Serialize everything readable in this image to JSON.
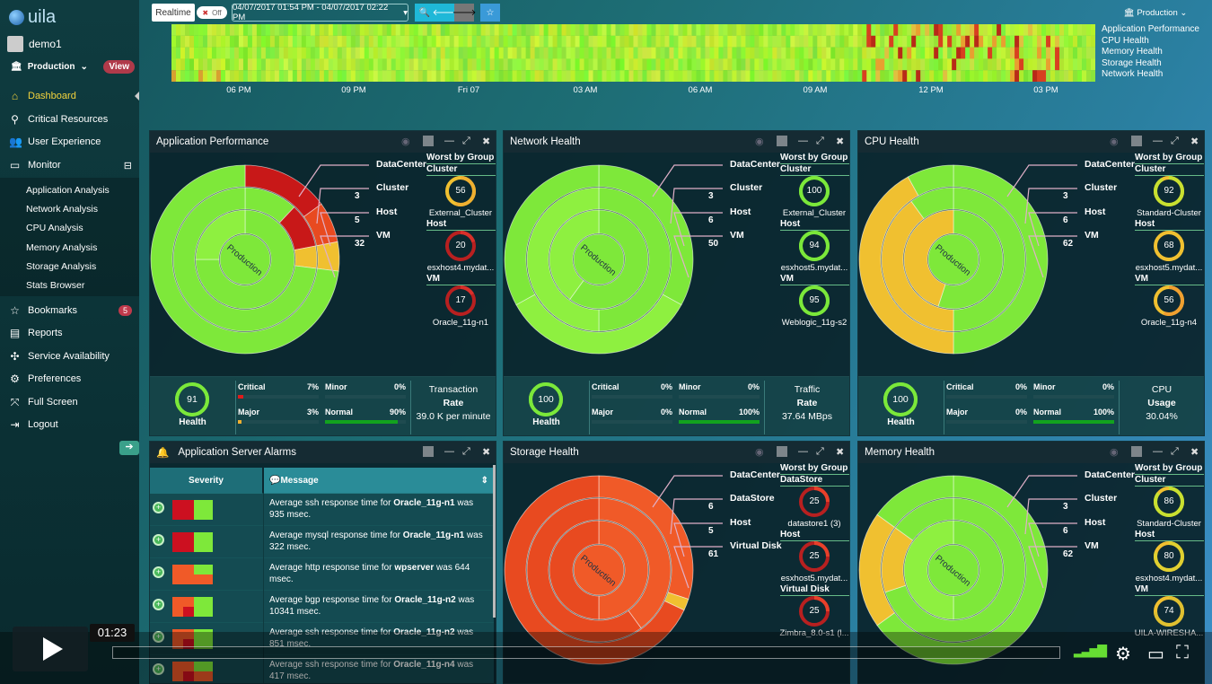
{
  "app": {
    "logo": "uila",
    "user": "demo1",
    "environment": "Production",
    "view_label": "View"
  },
  "nav": {
    "items": [
      {
        "label": "Dashboard",
        "icon": "home-icon"
      },
      {
        "label": "Critical Resources",
        "icon": "map-pin-icon"
      },
      {
        "label": "User Experience",
        "icon": "users-icon"
      },
      {
        "label": "Monitor",
        "icon": "monitor-icon",
        "toggle": "⊟"
      },
      {
        "label": "Bookmarks",
        "icon": "star-icon",
        "badge": "5"
      },
      {
        "label": "Reports",
        "icon": "report-icon"
      },
      {
        "label": "Service Availability",
        "icon": "settings-network-icon"
      },
      {
        "label": "Preferences",
        "icon": "preferences-icon"
      },
      {
        "label": "Full Screen",
        "icon": "fullscreen-icon"
      },
      {
        "label": "Logout",
        "icon": "logout-icon"
      }
    ],
    "monitor_sub": [
      "Application Analysis",
      "Network Analysis",
      "CPU Analysis",
      "Memory Analysis",
      "Storage Analysis",
      "Stats Browser"
    ]
  },
  "toolbar": {
    "realtime": "Realtime",
    "toggle_state": "Off",
    "date_range": "04/07/2017 01:54 PM - 04/07/2017 02:22 PM",
    "environment": "Production"
  },
  "timeline": {
    "ticks": [
      "06 PM",
      "09 PM",
      "Fri 07",
      "03 AM",
      "06 AM",
      "09 AM",
      "12 PM",
      "03 PM"
    ],
    "rows": [
      "Application Performance",
      "CPU Health",
      "Memory Health",
      "Storage Health",
      "Network Health"
    ]
  },
  "worst_title": "Worst by Group",
  "panels": [
    {
      "id": "app",
      "title": "Application Performance",
      "center": "Production",
      "legend": [
        {
          "label": "DataCenter",
          "count": ""
        },
        {
          "label": "Cluster",
          "count": "3"
        },
        {
          "label": "Host",
          "count": "5"
        },
        {
          "label": "VM",
          "count": "32"
        }
      ],
      "worst": [
        {
          "group": "Cluster",
          "value": 56,
          "name": "External_Cluster",
          "color": "#f0b030"
        },
        {
          "group": "Host",
          "value": 20,
          "name": "esxhost4.mydat...",
          "color": "#d8302a"
        },
        {
          "group": "VM",
          "value": 17,
          "name": "Oracle_11g-n1",
          "color": "#d8302a"
        }
      ],
      "health": 91,
      "health_label": "Health",
      "severity": [
        {
          "label": "Critical",
          "pct": 7,
          "color": "#e01b1b"
        },
        {
          "label": "Minor",
          "pct": 0,
          "color": "#f0b030"
        },
        {
          "label": "Major",
          "pct": 3,
          "color": "#f0b030"
        },
        {
          "label": "Normal",
          "pct": 90,
          "color": "#12a21e"
        }
      ],
      "metric": [
        "Transaction",
        "Rate",
        "39.0 K per minute"
      ]
    },
    {
      "id": "net",
      "title": "Network Health",
      "center": "Production",
      "legend": [
        {
          "label": "DataCenter",
          "count": ""
        },
        {
          "label": "Cluster",
          "count": "3"
        },
        {
          "label": "Host",
          "count": "6"
        },
        {
          "label": "VM",
          "count": "50"
        }
      ],
      "worst": [
        {
          "group": "Cluster",
          "value": 100,
          "name": "External_Cluster",
          "color": "#7be83a"
        },
        {
          "group": "Host",
          "value": 94,
          "name": "esxhost5.mydat...",
          "color": "#7be83a"
        },
        {
          "group": "VM",
          "value": 95,
          "name": "Weblogic_11g-s2",
          "color": "#7be83a"
        }
      ],
      "health": 100,
      "health_label": "Health",
      "severity": [
        {
          "label": "Critical",
          "pct": 0,
          "color": "#e01b1b"
        },
        {
          "label": "Minor",
          "pct": 0,
          "color": "#f0b030"
        },
        {
          "label": "Major",
          "pct": 0,
          "color": "#f0b030"
        },
        {
          "label": "Normal",
          "pct": 100,
          "color": "#12a21e"
        }
      ],
      "metric": [
        "Traffic",
        "Rate",
        "37.64 MBps"
      ]
    },
    {
      "id": "cpu",
      "title": "CPU Health",
      "center": "Production",
      "legend": [
        {
          "label": "DataCenter",
          "count": ""
        },
        {
          "label": "Cluster",
          "count": "3"
        },
        {
          "label": "Host",
          "count": "6"
        },
        {
          "label": "VM",
          "count": "62"
        }
      ],
      "worst": [
        {
          "group": "Cluster",
          "value": 92,
          "name": "Standard-Cluster",
          "color": "#c8e030"
        },
        {
          "group": "Host",
          "value": 68,
          "name": "esxhost5.mydat...",
          "color": "#f0c030"
        },
        {
          "group": "VM",
          "value": 56,
          "name": "Oracle_11g-n4",
          "color": "#f0a030"
        }
      ],
      "health": 100,
      "health_label": "Health",
      "severity": [
        {
          "label": "Critical",
          "pct": 0,
          "color": "#e01b1b"
        },
        {
          "label": "Minor",
          "pct": 0,
          "color": "#f0b030"
        },
        {
          "label": "Major",
          "pct": 0,
          "color": "#f0b030"
        },
        {
          "label": "Normal",
          "pct": 100,
          "color": "#12a21e"
        }
      ],
      "metric": [
        "CPU",
        "Usage",
        "30.04%"
      ]
    },
    {
      "id": "sto",
      "title": "Storage Health",
      "center": "Production",
      "legend": [
        {
          "label": "DataCenter",
          "count": ""
        },
        {
          "label": "DataStore",
          "count": "6"
        },
        {
          "label": "Host",
          "count": "5"
        },
        {
          "label": "Virtual Disk",
          "count": "61"
        }
      ],
      "worst": [
        {
          "group": "DataStore",
          "value": 25,
          "name": "datastore1 (3)",
          "color": "#e8402a"
        },
        {
          "group": "Host",
          "value": 25,
          "name": "esxhost5.mydat...",
          "color": "#e8402a"
        },
        {
          "group": "Virtual Disk",
          "value": 25,
          "name": "Zimbra_8.0-s1 (l...",
          "color": "#e8402a"
        }
      ]
    },
    {
      "id": "mem",
      "title": "Memory Health",
      "center": "Production",
      "legend": [
        {
          "label": "DataCenter",
          "count": ""
        },
        {
          "label": "Cluster",
          "count": "3"
        },
        {
          "label": "Host",
          "count": "6"
        },
        {
          "label": "VM",
          "count": "62"
        }
      ],
      "worst": [
        {
          "group": "Cluster",
          "value": 86,
          "name": "Standard-Cluster",
          "color": "#c8e030"
        },
        {
          "group": "Host",
          "value": 80,
          "name": "esxhost4.mydat...",
          "color": "#e0d030"
        },
        {
          "group": "VM",
          "value": 74,
          "name": "UILA-WIRESHA...",
          "color": "#e0c030"
        }
      ]
    }
  ],
  "alarms": {
    "title": "Application Server Alarms",
    "col_severity": "Severity",
    "col_message": "Message",
    "rows": [
      {
        "pre": "Average ssh response time for ",
        "bold": "Oracle_11g-n1",
        "post": " was 935 msec.",
        "colors": [
          "#cc1020",
          "#cc1020",
          "#7ee83a",
          "#7ee83a"
        ]
      },
      {
        "pre": "Average mysql response time for ",
        "bold": "Oracle_11g-n1",
        "post": " was 322 msec.",
        "colors": [
          "#cc1020",
          "#cc1020",
          "#7ee83a",
          "#7ee83a"
        ]
      },
      {
        "pre": "Average http response time for ",
        "bold": "wpserver",
        "post": " was 644 msec.",
        "colors": [
          "#f05a28",
          "#f05a28",
          "#7ee83a",
          "#f05a28"
        ]
      },
      {
        "pre": "Average bgp response time for ",
        "bold": "Oracle_11g-n2",
        "post": " was 10341 msec.",
        "colors": [
          "#f05a28",
          "#cc1020",
          "#7ee83a",
          "#7ee83a"
        ]
      },
      {
        "pre": "Average ssh response time for ",
        "bold": "Oracle_11g-n2",
        "post": " was 851 msec.",
        "colors": [
          "#f05a28",
          "#cc1020",
          "#7ee83a",
          "#7ee83a"
        ]
      },
      {
        "pre": "Average ssh response time for ",
        "bold": "Oracle_11g-n4",
        "post": " was 417 msec.",
        "colors": [
          "#f05a28",
          "#cc1020",
          "#7ee83a",
          "#f05a28"
        ]
      }
    ]
  },
  "video": {
    "time": "01:23",
    "progress_pct": 0
  }
}
